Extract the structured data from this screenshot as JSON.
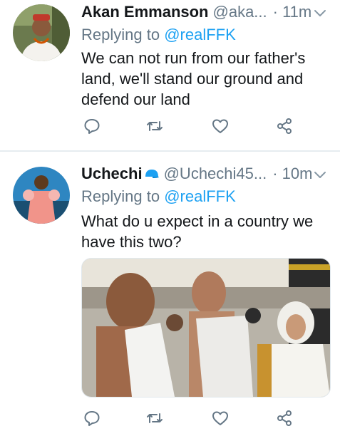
{
  "tweets": [
    {
      "name": "Akan Emmanson",
      "handle": "@aka...",
      "time": "· 11m",
      "replying_prefix": "Replying to",
      "replying_to": "@realFFK",
      "text": "We can not run from our father's land, we'll stand our ground and defend our land"
    },
    {
      "name": "Uchechi",
      "name_emoji": "blue-cap-emoji",
      "handle": "@Uchechi45...",
      "time": "· 10m",
      "replying_prefix": "Replying to",
      "replying_to": "@realFFK",
      "text": "What do u expect in a country we have this two?"
    }
  ],
  "icons": [
    "reply-icon",
    "retweet-icon",
    "like-icon",
    "share-icon",
    "chevron-down-icon"
  ],
  "colors": {
    "link": "#1da1f2",
    "muted": "#657786",
    "text": "#14171a",
    "divider": "#e6ecf0"
  }
}
